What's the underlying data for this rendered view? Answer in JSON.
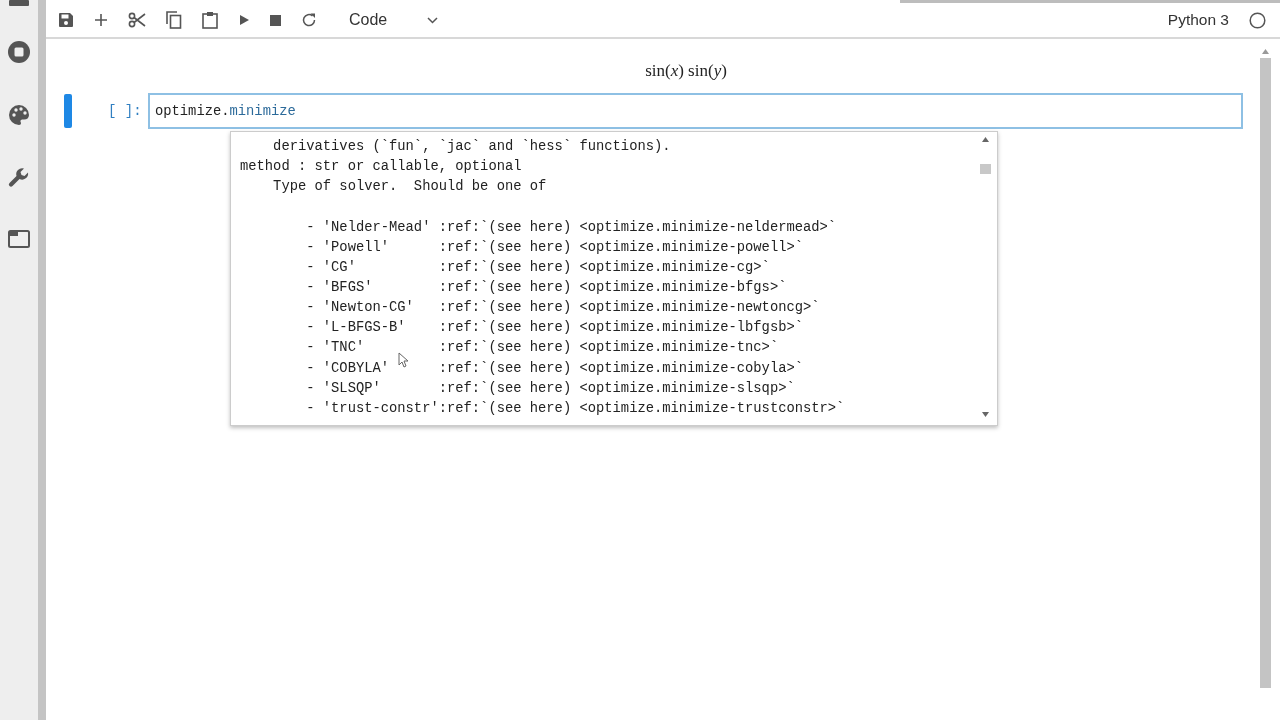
{
  "toolbar": {
    "cell_type": "Code",
    "kernel_name": "Python 3",
    "kernel_busy": false
  },
  "output": {
    "math": "sin(*x*) sin(*y*)"
  },
  "cell": {
    "prompt": "[ ]:",
    "active": true,
    "code_object": "optimize.",
    "code_attribute": "minimize"
  },
  "tooltip": {
    "header_lines": [
      "    derivatives (`fun`, `jac` and `hess` functions).",
      "method : str or callable, optional",
      "    Type of solver.  Should be one of"
    ],
    "option_lines": [
      "        - 'Nelder-Mead' :ref:`(see here) <optimize.minimize-neldermead>`",
      "        - 'Powell'      :ref:`(see here) <optimize.minimize-powell>`",
      "        - 'CG'          :ref:`(see here) <optimize.minimize-cg>`",
      "        - 'BFGS'        :ref:`(see here) <optimize.minimize-bfgs>`",
      "        - 'Newton-CG'   :ref:`(see here) <optimize.minimize-newtoncg>`",
      "        - 'L-BFGS-B'    :ref:`(see here) <optimize.minimize-lbfgsb>`",
      "        - 'TNC'         :ref:`(see here) <optimize.minimize-tnc>`",
      "        - 'COBYLA'      :ref:`(see here) <optimize.minimize-cobyla>`",
      "        - 'SLSQP'       :ref:`(see here) <optimize.minimize-slsqp>`",
      "        - 'trust-constr':ref:`(see here) <optimize.minimize-trustconstr>`"
    ]
  }
}
